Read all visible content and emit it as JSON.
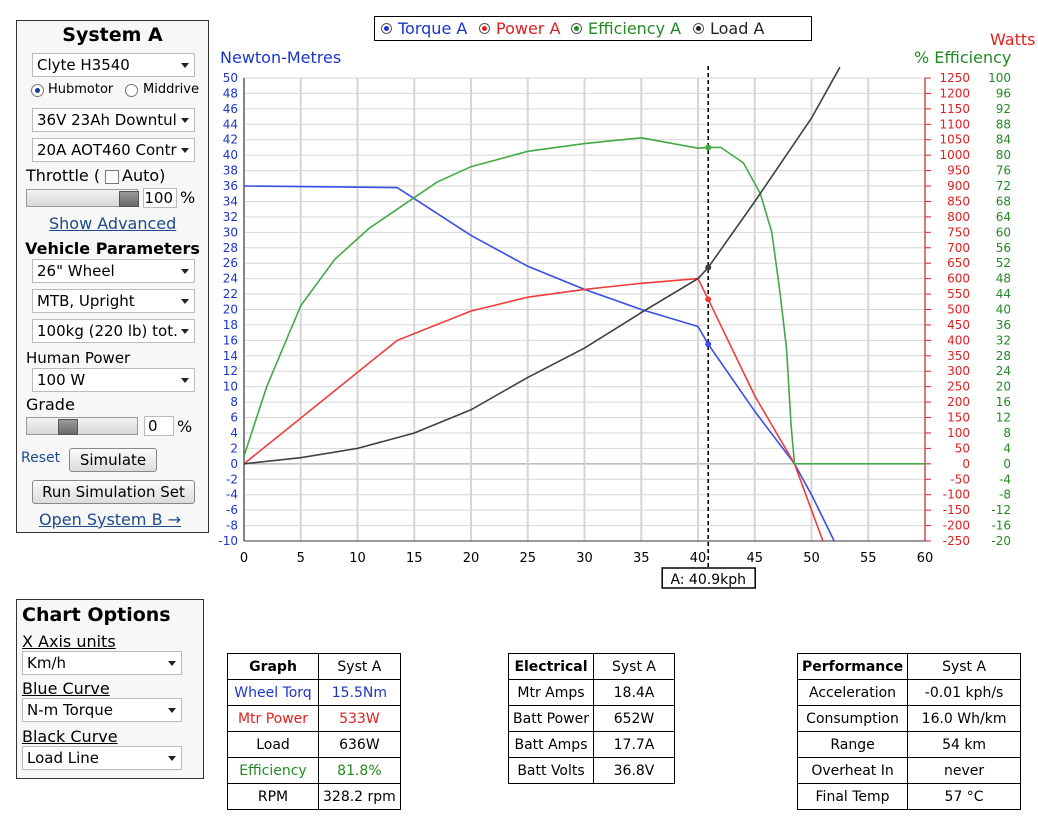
{
  "system_panel": {
    "title": "System A",
    "motor": "Clyte H3540",
    "radio_hub": "Hubmotor",
    "radio_mid": "Middrive",
    "battery": "36V 23Ah Downtul",
    "controller": "20A AOT460 Contr",
    "throttle_label": "Throttle (",
    "auto_label": "Auto)",
    "throttle_value": "100",
    "percent": "%",
    "show_advanced": "Show Advanced",
    "vehicle_title": "Vehicle Parameters",
    "wheel": "26\"  Wheel",
    "bike_type": "MTB, Upright",
    "weight": "100kg (220 lb) tot.",
    "human_power_label": "Human Power",
    "human_power": "100 W",
    "grade_label": "Grade",
    "grade_value": "0",
    "reset": "Reset",
    "simulate": "Simulate",
    "run_set": "Run Simulation Set",
    "open_b": "Open System B →"
  },
  "chart_options": {
    "title": "Chart Options",
    "x_axis_label": "X Axis units",
    "x_axis_value": "Km/h",
    "blue_label": "Blue Curve",
    "blue_value": "N-m Torque",
    "black_label": "Black Curve",
    "black_value": "Load Line"
  },
  "legend": {
    "torque": "Torque A",
    "power": "Power A",
    "efficiency": "Efficiency A",
    "load": "Load A"
  },
  "colors": {
    "torque": "#3a4ee6",
    "power": "#f03c3c",
    "efficiency": "#44a844",
    "load": "#404040",
    "axis_left": "#1a35c8",
    "axis_watts": "#e02020",
    "axis_eff": "#238a23"
  },
  "chart_data": {
    "type": "line",
    "ylabel_left": "Newton-Metres",
    "ylabel_right_1": "Watts",
    "ylabel_right_2": "% Efficiency",
    "xlim": [
      0,
      60
    ],
    "ylim_left": [
      -10,
      50
    ],
    "ylim_watts": [
      -250,
      1250
    ],
    "ylim_eff": [
      -20,
      100
    ],
    "x_ticks": [
      0,
      5,
      10,
      15,
      20,
      25,
      30,
      35,
      40,
      45,
      50,
      55,
      60
    ],
    "left_ticks": [
      50,
      48,
      46,
      44,
      42,
      40,
      38,
      36,
      34,
      32,
      30,
      28,
      26,
      24,
      22,
      20,
      18,
      16,
      14,
      12,
      10,
      8,
      6,
      4,
      2,
      0,
      -2,
      -4,
      -6,
      -8,
      -10
    ],
    "watts_ticks": [
      1250,
      1200,
      1150,
      1100,
      1050,
      1000,
      950,
      900,
      850,
      800,
      750,
      700,
      650,
      600,
      550,
      500,
      450,
      400,
      350,
      300,
      250,
      200,
      150,
      100,
      50,
      0,
      -50,
      -100,
      -150,
      -200,
      -250
    ],
    "eff_ticks": [
      100,
      96,
      92,
      88,
      84,
      80,
      76,
      72,
      68,
      64,
      60,
      56,
      52,
      48,
      44,
      40,
      36,
      32,
      28,
      24,
      20,
      16,
      12,
      8,
      4,
      0,
      -4,
      -8,
      -12,
      -16,
      -20
    ],
    "grid": true,
    "cursor_x": 40.9,
    "cursor_label": "A: 40.9kph",
    "series": [
      {
        "name": "Torque A",
        "axis": "left",
        "x": [
          0,
          13.5,
          20,
          25,
          30,
          35,
          40,
          40.9,
          45,
          48.5,
          50,
          52
        ],
        "y": [
          36,
          35.8,
          29.6,
          25.6,
          22.6,
          20,
          17.8,
          15.5,
          6.8,
          0,
          -4,
          -10
        ]
      },
      {
        "name": "Power A",
        "axis": "watts",
        "x": [
          0,
          13.5,
          20,
          25,
          30,
          35,
          40,
          40.9,
          45,
          48.5,
          50,
          51
        ],
        "y": [
          0,
          400,
          495,
          540,
          565,
          585,
          600,
          533,
          220,
          0,
          -150,
          -250
        ]
      },
      {
        "name": "Efficiency A",
        "axis": "eff",
        "x": [
          0,
          2,
          5,
          8,
          11,
          13.5,
          17,
          20,
          25,
          30,
          35,
          40,
          40.9,
          42,
          44,
          45.5,
          46.5,
          47.2,
          47.8,
          48.2,
          48.5,
          60
        ],
        "y": [
          2,
          20,
          41,
          53,
          61,
          66,
          73,
          77,
          81,
          83,
          84.5,
          81.8,
          82,
          82,
          78,
          70,
          60,
          45,
          30,
          10,
          0,
          0
        ]
      },
      {
        "name": "Load A",
        "axis": "watts",
        "x": [
          0,
          5,
          10,
          15,
          20,
          25,
          30,
          35,
          40,
          40.9,
          45,
          50,
          52.5
        ],
        "y": [
          0,
          20,
          50,
          100,
          175,
          280,
          375,
          490,
          600,
          636,
          850,
          1120,
          1285
        ]
      }
    ]
  },
  "graph_table": {
    "headers": [
      "Graph",
      "Syst A"
    ],
    "rows": [
      [
        "Wheel Torq",
        "15.5Nm"
      ],
      [
        "Mtr Power",
        "533W"
      ],
      [
        "Load",
        "636W"
      ],
      [
        "Efficiency",
        "81.8%"
      ],
      [
        "RPM",
        "328.2 rpm"
      ]
    ]
  },
  "electrical_table": {
    "headers": [
      "Electrical",
      "Syst A"
    ],
    "rows": [
      [
        "Mtr Amps",
        "18.4A"
      ],
      [
        "Batt Power",
        "652W"
      ],
      [
        "Batt Amps",
        "17.7A"
      ],
      [
        "Batt Volts",
        "36.8V"
      ]
    ]
  },
  "performance_table": {
    "headers": [
      "Performance",
      "Syst A"
    ],
    "rows": [
      [
        "Acceleration",
        "-0.01 kph/s"
      ],
      [
        "Consumption",
        "16.0 Wh/km"
      ],
      [
        "Range",
        "54 km"
      ],
      [
        "Overheat In",
        "never"
      ],
      [
        "Final Temp",
        "57 °C"
      ]
    ]
  }
}
